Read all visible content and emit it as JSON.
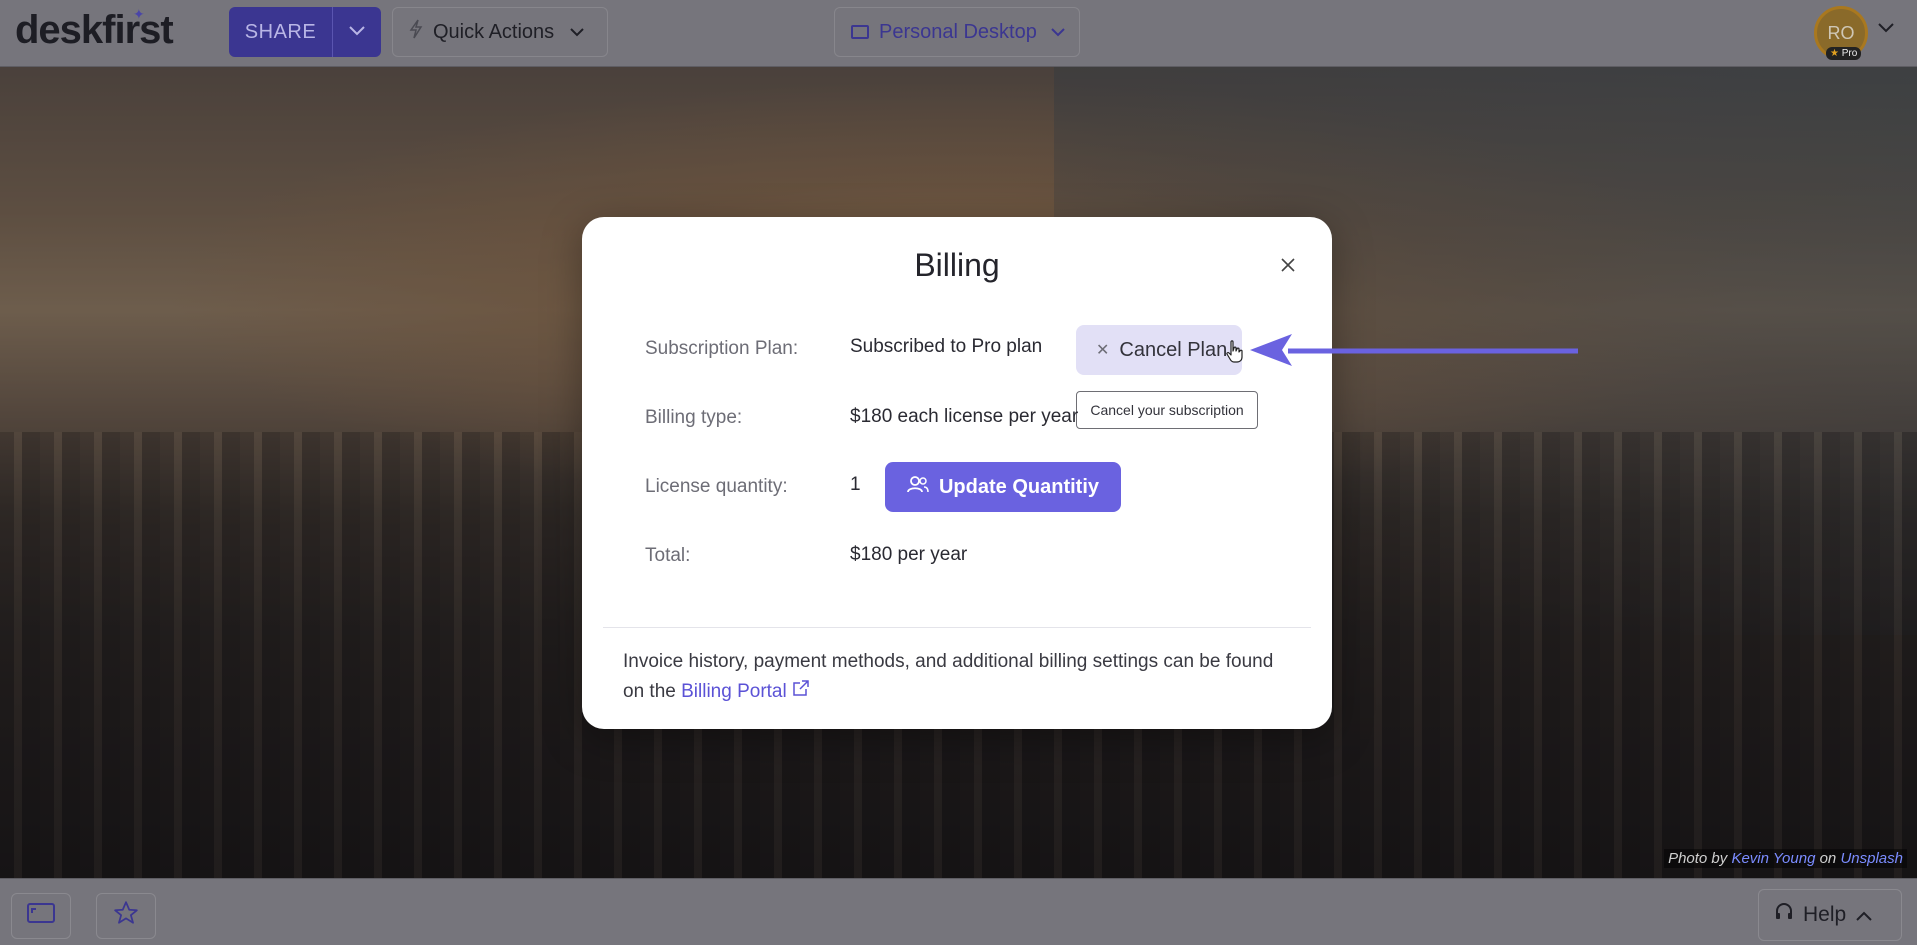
{
  "topbar": {
    "logo": "deskfirst",
    "share_label": "SHARE",
    "quick_actions_label": "Quick Actions",
    "desktop_label": "Personal Desktop",
    "avatar_initials": "RO",
    "pro_badge": "Pro"
  },
  "modal": {
    "title": "Billing",
    "rows": [
      {
        "label": "Subscription Plan:",
        "value": "Subscribed to Pro plan"
      },
      {
        "label": "Billing type:",
        "value": "$180 each license per year"
      },
      {
        "label": "License quantity:",
        "value": "1"
      },
      {
        "label": "Total:",
        "value": "$180 per year"
      }
    ],
    "cancel_label": "Cancel Plan",
    "tooltip": "Cancel your subscription",
    "update_label": "Update Quantitiy",
    "footer_prefix": "Invoice history, payment methods, and additional billing settings can be found on the",
    "portal_link": "Billing Portal"
  },
  "credit": {
    "prefix": "Photo by",
    "author": "Kevin Young",
    "on": "on",
    "site": "Unsplash"
  },
  "bottombar": {
    "help_label": "Help"
  },
  "colors": {
    "accent": "#6a62e0",
    "accent_dark": "#3b3691"
  }
}
